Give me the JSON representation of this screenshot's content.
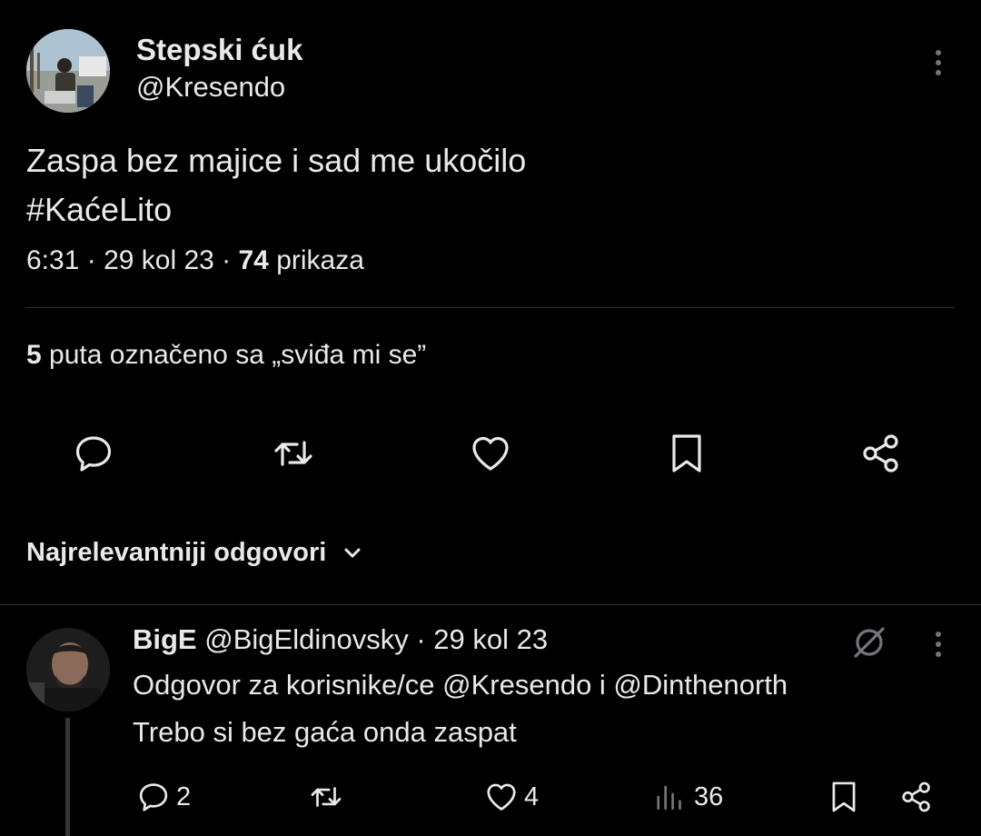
{
  "tweet": {
    "author_name": "Stepski ćuk",
    "author_handle": "@Kresendo",
    "text_line1": "Zaspa bez majice i sad me ukočilo",
    "text_line2": "#KaćeLito",
    "time": "6:31",
    "date": "29 kol 23",
    "views_count": "74",
    "views_label": "prikaza",
    "separator": " · ",
    "likes_count": "5",
    "likes_label": "puta označeno sa „sviđa mi se”"
  },
  "actions": [
    "comment-icon",
    "retweet-icon",
    "heart-icon",
    "bookmark-icon",
    "share-icon"
  ],
  "replies_sort": {
    "label": "Najrelevantniji odgovori"
  },
  "reply": {
    "name": "BigE",
    "handle": "@BigEldinovsky",
    "date_sep": " · ",
    "date": "29 kol 23",
    "reply_to": "Odgovor za korisnike/ce @Kresendo i @Dinthenorth",
    "text": "Trebo si bez gaća onda zaspat",
    "comments": "2",
    "retweets": "",
    "likes": "4",
    "views": "36"
  },
  "colors": {
    "background": "#000000",
    "text": "#e7e9ea",
    "divider": "#2f3336",
    "icon": "#e7e9ea"
  }
}
